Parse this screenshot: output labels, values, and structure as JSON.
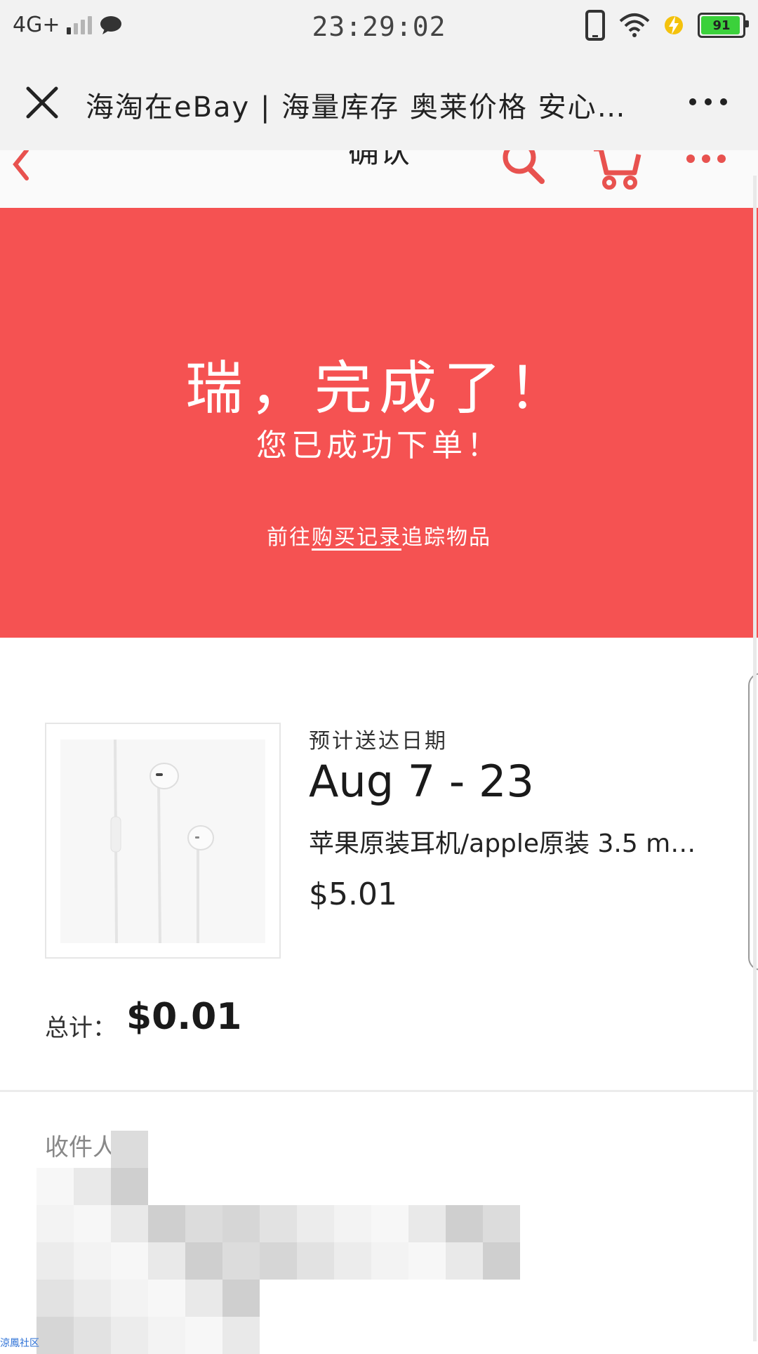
{
  "status_bar": {
    "network": "4G+",
    "time": "23:29:02",
    "battery": "91",
    "icons": [
      "signal-icon",
      "chat-bubble-icon",
      "phone-outline-icon",
      "wifi-icon",
      "charging-bolt-icon",
      "battery-icon"
    ]
  },
  "webview": {
    "title": "海淘在eBay | 海量库存 奥莱价格 安心…",
    "icons": [
      "close-icon",
      "more-dots-icon"
    ]
  },
  "site_header": {
    "title": "确认",
    "icons": [
      "back-chevron-icon",
      "search-icon",
      "cart-icon",
      "more-dots-icon"
    ],
    "accent_color": "#e8524f"
  },
  "banner": {
    "headline": "瑞，完成了！",
    "subtitle": "您已成功下单！",
    "link_prefix": "前往",
    "link_text": "购买记录",
    "link_suffix": "追踪物品",
    "background_color": "#f55252"
  },
  "order": {
    "delivery_label": "预计送达日期",
    "delivery_date": "Aug 7 - 23",
    "product_title": "苹果原装耳机/apple原装 3.5 mm...",
    "price": "$5.01",
    "total_label": "总计：",
    "total_value": "$0.01"
  },
  "shipping": {
    "label": "收件人"
  },
  "watermark": "涼鳳社区"
}
